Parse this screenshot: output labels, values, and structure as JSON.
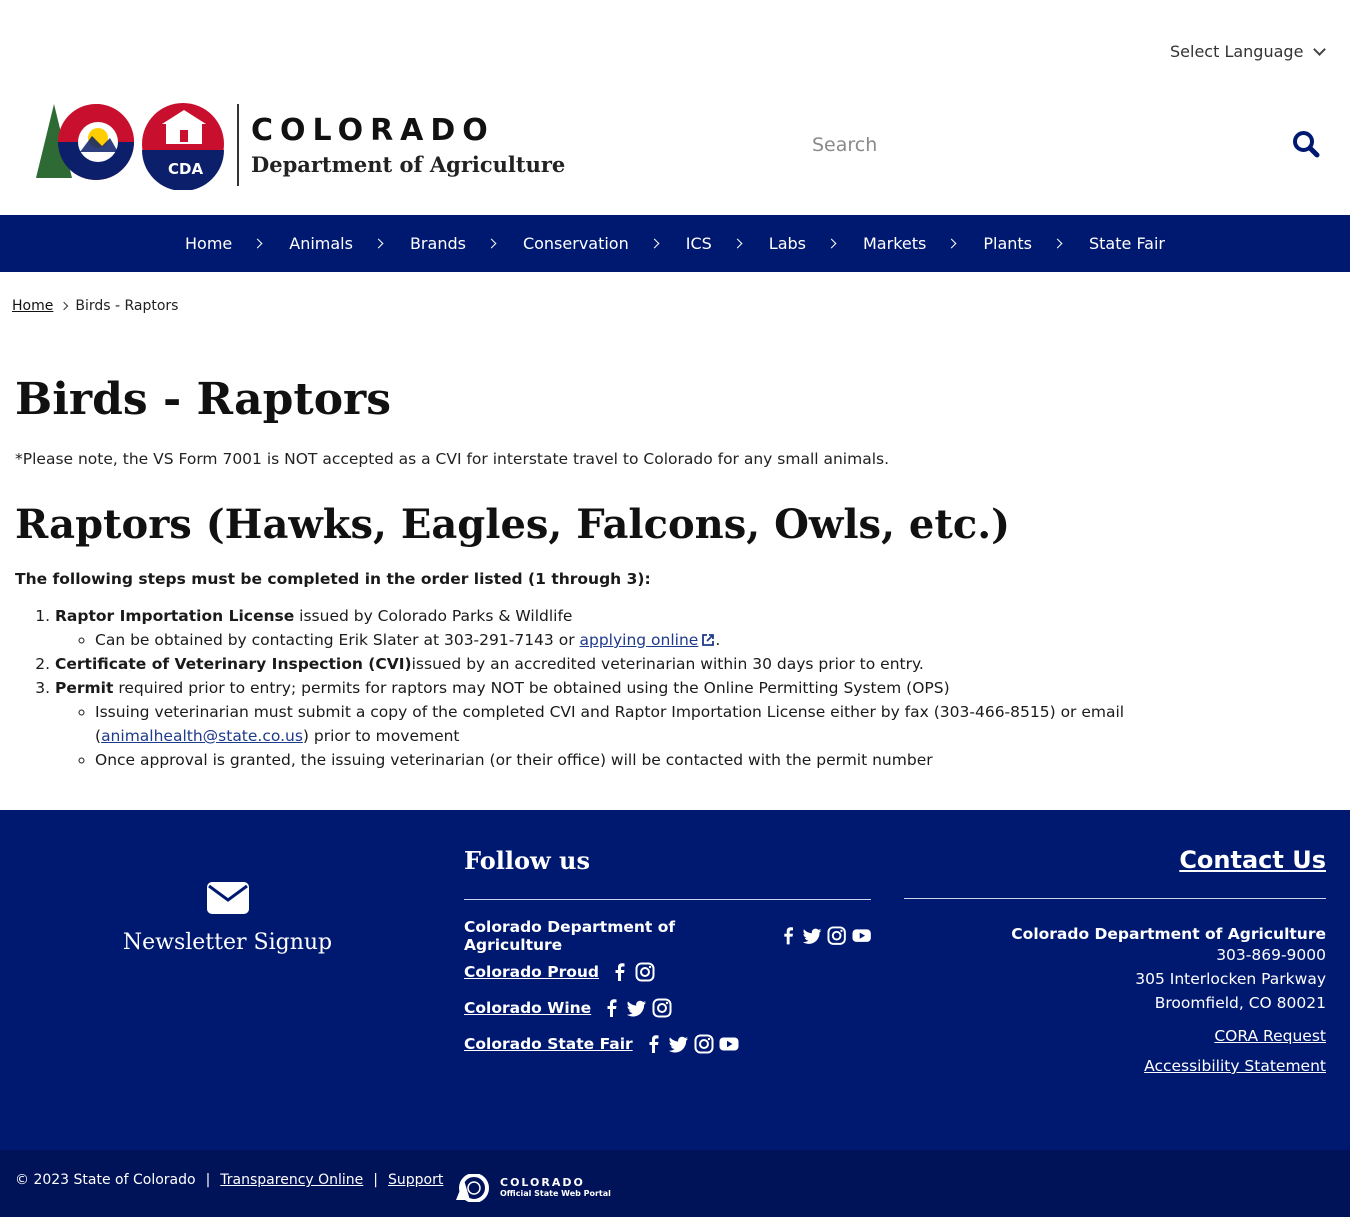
{
  "language": {
    "label": "Select Language"
  },
  "header": {
    "logo_state": "COLORADO",
    "logo_dept": "Department of Agriculture",
    "logo_badge": "CDA",
    "search_placeholder": "Search"
  },
  "nav": {
    "items": [
      {
        "label": "Home"
      },
      {
        "label": "Animals"
      },
      {
        "label": "Brands"
      },
      {
        "label": "Conservation"
      },
      {
        "label": "ICS"
      },
      {
        "label": "Labs"
      },
      {
        "label": "Markets"
      },
      {
        "label": "Plants"
      },
      {
        "label": "State Fair"
      }
    ]
  },
  "breadcrumb": {
    "home": "Home",
    "current": "Birds - Raptors"
  },
  "content": {
    "title": "Birds - Raptors",
    "note": "*Please note, the VS Form 7001 is NOT accepted as a CVI for interstate travel to Colorado for any small animals.",
    "section_title": "Raptors (Hawks, Eagles, Falcons, Owls, etc.)",
    "steps_intro": "The following steps must be completed in the order listed (1 through 3):",
    "step1": {
      "bold": "Raptor Importation License",
      "rest": " issued by Colorado Parks & Wildlife",
      "sub1_pre": "Can be obtained by contacting Erik Slater at 303-291-7143 or ",
      "sub1_link": "applying online",
      "sub1_post": "."
    },
    "step2": {
      "bold": "Certificate of Veterinary Inspection (CVI)",
      "rest": "issued by an accredited veterinarian within 30 days prior to entry."
    },
    "step3": {
      "bold": "Permit",
      "rest": " required prior to entry; permits for raptors may NOT be obtained using the Online Permitting System (OPS)",
      "sub1_pre": "Issuing veterinarian must submit a copy of the completed CVI and Raptor Importation License either by fax (303-466-8515) or email (",
      "sub1_link": "animalhealth@state.co.us",
      "sub1_post": ") prior to movement",
      "sub2": "Once approval is granted, the issuing veterinarian (or their office) will be contacted with the permit number"
    }
  },
  "footer": {
    "newsletter": "Newsletter Signup",
    "follow_title": "Follow us",
    "follow": [
      {
        "name": "Colorado Department of Agriculture",
        "icons": [
          "facebook-icon",
          "twitter-icon",
          "instagram-icon",
          "youtube-icon"
        ]
      },
      {
        "name": "Colorado Proud",
        "icons": [
          "facebook-icon",
          "instagram-icon"
        ]
      },
      {
        "name": "Colorado Wine",
        "icons": [
          "facebook-icon",
          "twitter-icon",
          "instagram-icon"
        ]
      },
      {
        "name": "Colorado State Fair",
        "icons": [
          "facebook-icon",
          "twitter-icon",
          "instagram-icon",
          "youtube-icon"
        ]
      }
    ],
    "contact_title": "Contact Us",
    "contact_org": "Colorado Department of Agriculture",
    "contact_phone": "303-869-9000",
    "contact_addr1": "305 Interlocken Parkway",
    "contact_addr2": "Broomfield, CO 80021",
    "cora": "CORA Request",
    "accessibility": "Accessibility Statement"
  },
  "bottom": {
    "copyright": "© 2023 State of Colorado",
    "sep": "|",
    "transparency": "Transparency Online",
    "support": "Support",
    "portal_line1": "COLORADO",
    "portal_line2": "Official State Web Portal"
  },
  "colors": {
    "navy": "#001970",
    "bottom_navy": "#001258",
    "link": "#1e3a8a",
    "logo_red": "#c8102e",
    "logo_gold": "#ffcd00"
  }
}
